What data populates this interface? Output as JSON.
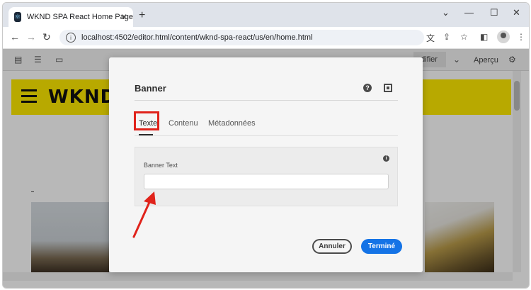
{
  "browser": {
    "tab_title": "WKND SPA React Home Page",
    "url": "localhost:4502/editor.html/content/wknd-spa-react/us/en/home.html"
  },
  "editor_toolbar": {
    "modifier_label": "odifier",
    "apercu_label": "Aperçu"
  },
  "site": {
    "logo": "WKND"
  },
  "dialog": {
    "title": "Banner",
    "tabs": [
      {
        "label": "Texte",
        "active": true
      },
      {
        "label": "Contenu",
        "active": false
      },
      {
        "label": "Métadonnées",
        "active": false
      }
    ],
    "field": {
      "label": "Banner Text",
      "value": ""
    },
    "cancel_label": "Annuler",
    "done_label": "Terminé"
  },
  "colors": {
    "accent_blue": "#1473e6",
    "highlight_red": "#e0231b",
    "wknd_yellow": "#ffea00"
  },
  "icons": {
    "help": "help-icon",
    "fullscreen": "fullscreen-icon",
    "info": "info-icon"
  }
}
